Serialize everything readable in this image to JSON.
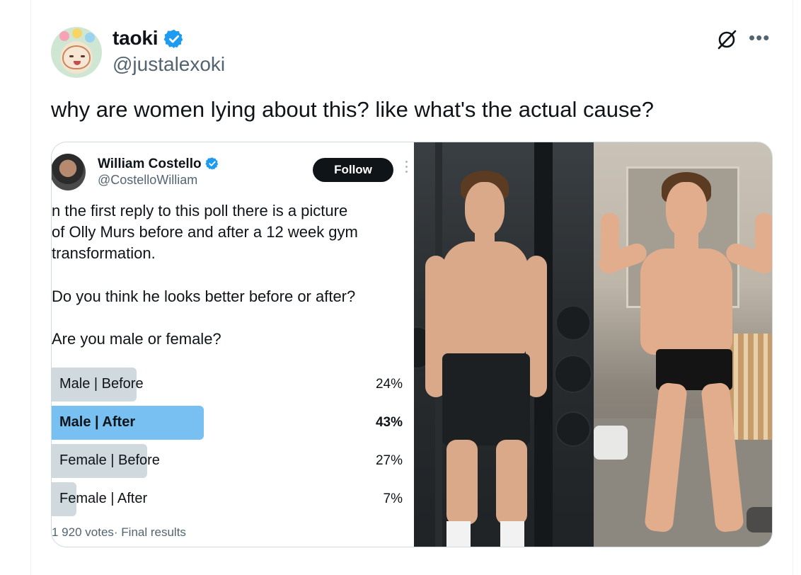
{
  "tweet": {
    "author_name": "taoki",
    "author_handle": "@justalexoki",
    "text": "why are women lying about this? like what's the actual cause?"
  },
  "quoted_poll": {
    "author_name": "William Costello",
    "author_handle": "@CostelloWilliam",
    "follow_label": "Follow",
    "text_lines": [
      "n the first reply to this poll there is a picture",
      "of Olly Murs before and after a 12 week gym",
      "transformation.",
      "Do you think he looks better before or after?",
      "Are you male or female?"
    ],
    "options": [
      {
        "label": "Male | Before",
        "percent_label": "24%",
        "percent": 24,
        "winner": false
      },
      {
        "label": "Male | After",
        "percent_label": "43%",
        "percent": 43,
        "winner": true
      },
      {
        "label": "Female | Before",
        "percent_label": "27%",
        "percent": 27,
        "winner": false
      },
      {
        "label": "Female | After",
        "percent_label": "7%",
        "percent": 7,
        "winner": false
      }
    ],
    "footer": "1 920 votes· Final results"
  },
  "colors": {
    "verified": "#1d9bf0",
    "poll_winner": "#78c0f2",
    "poll_other": "#cfd9de",
    "secondary_text": "#536471"
  }
}
